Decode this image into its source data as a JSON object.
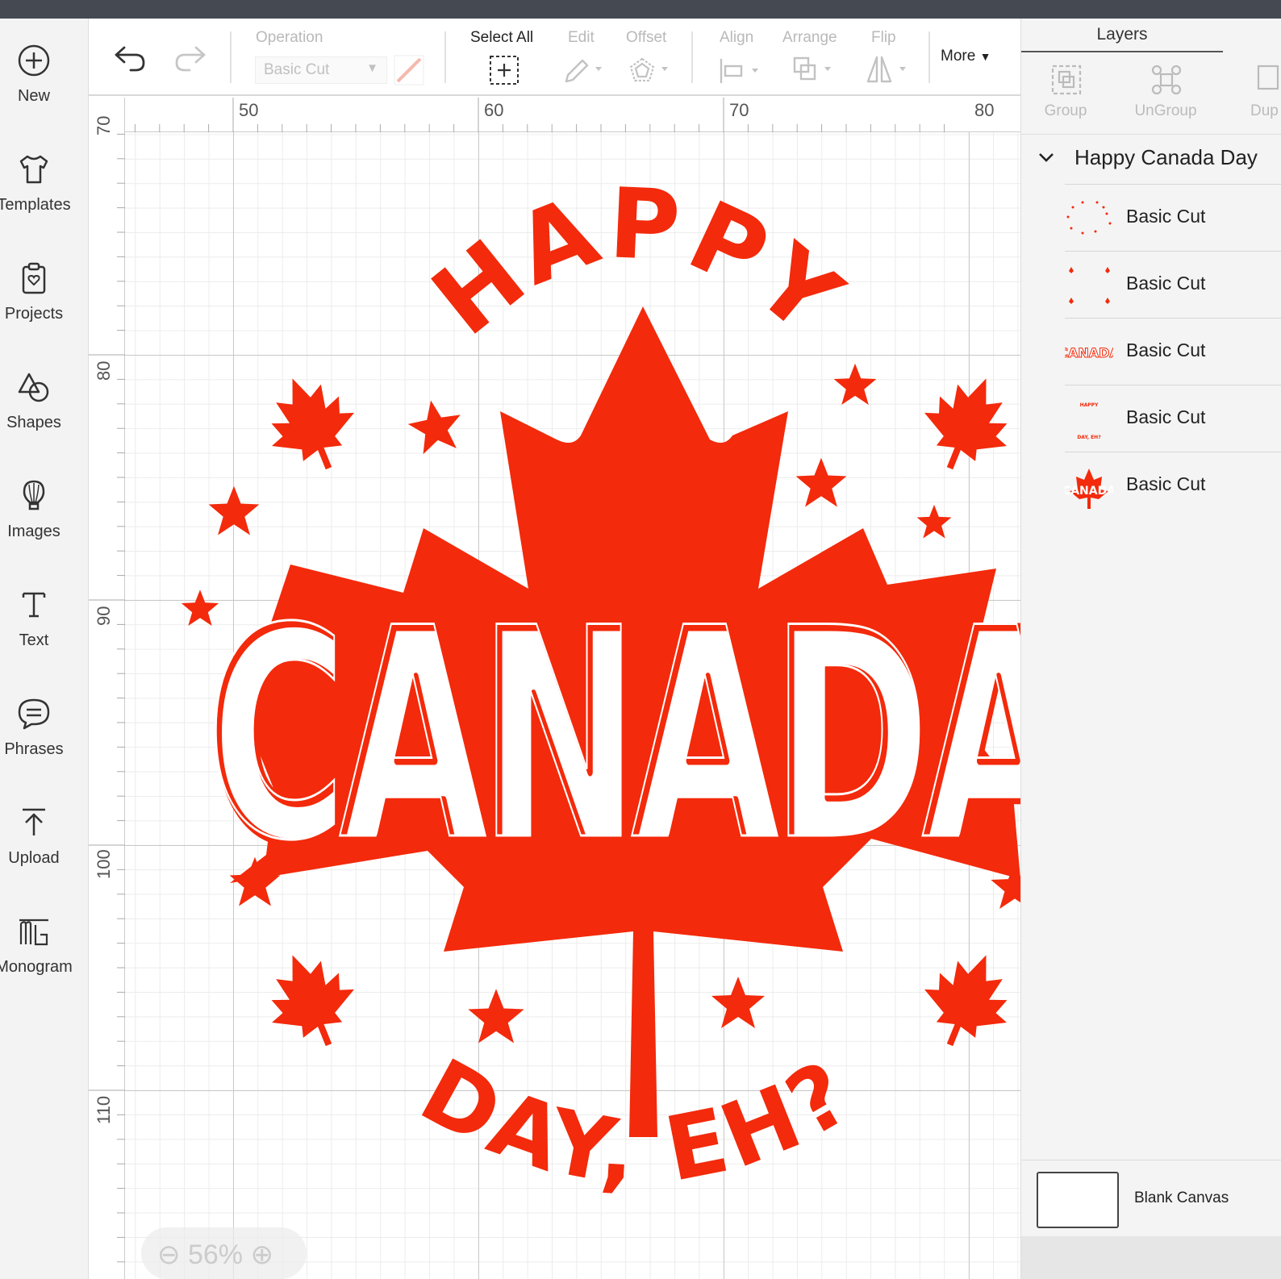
{
  "colors": {
    "accent": "#f32a0b",
    "sidebar_bg": "#f3f3f3",
    "panel_bg": "#f4f4f4"
  },
  "sidebar": {
    "items": [
      {
        "label": "New",
        "icon": "plus-circle-icon"
      },
      {
        "label": "Templates",
        "icon": "tshirt-icon"
      },
      {
        "label": "Projects",
        "icon": "clipboard-heart-icon"
      },
      {
        "label": "Shapes",
        "icon": "shapes-icon"
      },
      {
        "label": "Images",
        "icon": "lightbulb-icon"
      },
      {
        "label": "Text",
        "icon": "text-icon"
      },
      {
        "label": "Phrases",
        "icon": "speech-bubble-icon"
      },
      {
        "label": "Upload",
        "icon": "upload-icon"
      },
      {
        "label": "Monogram",
        "icon": "monogram-icon"
      }
    ]
  },
  "toolbar": {
    "operation_label": "Operation",
    "operation_value": "Basic Cut",
    "select_all_label": "Select All",
    "edit_label": "Edit",
    "offset_label": "Offset",
    "align_label": "Align",
    "arrange_label": "Arrange",
    "flip_label": "Flip",
    "more_label": "More"
  },
  "ruler": {
    "top": [
      "50",
      "60",
      "70",
      "80"
    ],
    "left": [
      "70",
      "80",
      "90",
      "100",
      "110"
    ]
  },
  "design": {
    "happy": "HAPPY",
    "canada": "CANADA",
    "day_eh": "DAY, EH?"
  },
  "zoom": {
    "minus": "⊖",
    "value": "56%",
    "plus": "⊕"
  },
  "panel": {
    "tab_label": "Layers",
    "actions": [
      {
        "label": "Group",
        "icon": "group-icon"
      },
      {
        "label": "UnGroup",
        "icon": "ungroup-icon"
      },
      {
        "label": "Dup",
        "icon": "duplicate-icon"
      }
    ],
    "group_name": "Happy Canada Day",
    "layers": [
      {
        "label": "Basic Cut",
        "thumb": "stars-thumb"
      },
      {
        "label": "Basic Cut",
        "thumb": "leaves-thumb"
      },
      {
        "label": "Basic Cut",
        "thumb": "canada-text-thumb"
      },
      {
        "label": "Basic Cut",
        "thumb": "happy-day-text-thumb"
      },
      {
        "label": "Basic Cut",
        "thumb": "full-design-thumb"
      }
    ],
    "blank_canvas_label": "Blank Canvas"
  }
}
